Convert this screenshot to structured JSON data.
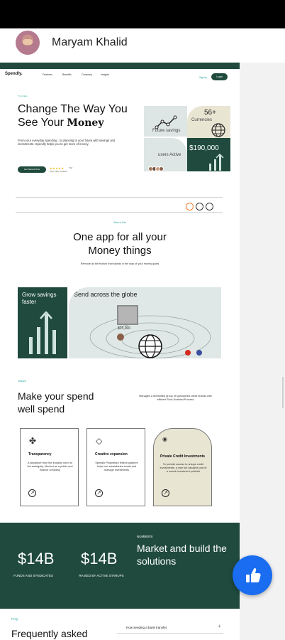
{
  "post": {
    "author_name": "Maryam Khalid"
  },
  "site": {
    "logo": "Spendly.",
    "nav_links": [
      "Features",
      "Benefits",
      "Company",
      "Insights"
    ],
    "signin_label": "Signup",
    "login_label": "Login",
    "hero": {
      "tagline": "Try it Now",
      "title_line1": "Change The Way You",
      "title_line2_prefix": "See Your ",
      "title_money": "Money",
      "description": "From your everyday spending , to planning to your future with savings and investments. Spendly helps you to get  more of money.",
      "cta_label": "Get Started Now",
      "stars": "★★★★★",
      "rating": "5.0",
      "reviews": "from 120+ reviews"
    },
    "tiles": {
      "savings_label": "Future savings",
      "currencies_count": "56+",
      "currencies_label": "Currencies",
      "users_label": "users Active",
      "amount": "$190,000"
    },
    "about": {
      "tag": "About Us!",
      "title_line1": "One app for all your",
      "title_line2": "Money things",
      "description": "Remove all the friction that stands in the way of your money goals"
    },
    "features": {
      "grow_title": "Grow savings faster",
      "send_title": "Send across the globe",
      "send_amount": "$25,000"
    },
    "values": {
      "tag": "Values",
      "title_line1": "Make your spend",
      "title_line2": "well spend",
      "description": "Manages  a diversified group of specialized credit brands with efficient Tech-Enabled Process",
      "cards": [
        {
          "title": "Transparency",
          "desc": "A departure from the industry norm of the ambiguity, Monfort as a public and finance company"
        },
        {
          "title": "Creative expansion",
          "desc": "Spendly Proprietary fintech platform helps our subsidiaries locate and manage investments"
        },
        {
          "title": "Private Credit Investments",
          "desc": "To provide access to unique credit investments, a rare but valuable part of a sound investment portfolio"
        }
      ]
    },
    "numbers": {
      "stat1_value": "$14B",
      "stat1_label": "FUNDS AND SYNDICATES",
      "stat2_value": "$14B",
      "stat2_label": "RAISED BY ACTIVE STARUPS",
      "tag": "NUMBERS",
      "title": "Market and build the solutions"
    },
    "faq": {
      "tag": "FAQ",
      "title": "Frequently asked",
      "question1": "How sending a bank transfer"
    }
  },
  "colors": {
    "brand_green": "#1f4a3d",
    "accent_teal": "#2aa5a0",
    "like_blue": "#1a6cf0"
  }
}
